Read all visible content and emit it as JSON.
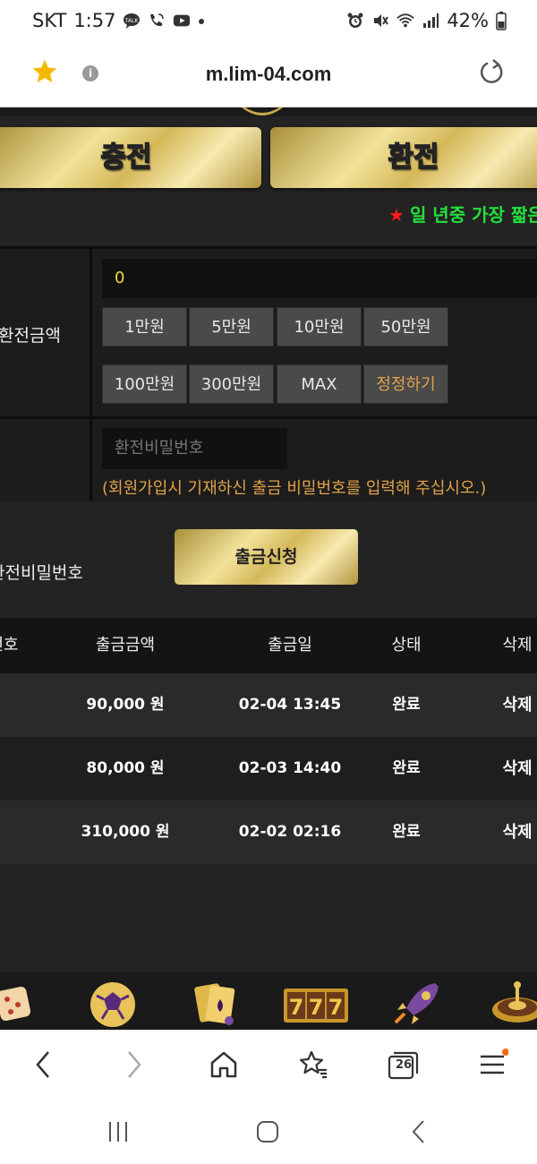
{
  "status_bar": {
    "carrier": "SKT",
    "time": "1:57",
    "battery": "42%",
    "left_icons": [
      "talk-icon",
      "wifi-call-icon",
      "youtube-icon",
      "dot-icon"
    ],
    "right_icons": [
      "alarm-icon",
      "mute-icon",
      "wifi-icon",
      "signal-icon",
      "battery-icon"
    ]
  },
  "browser": {
    "url": "m.lim-04.com",
    "tab_count": "26"
  },
  "tabs": {
    "deposit": "충전",
    "withdraw": "환전"
  },
  "marquee": {
    "text": "일 년중 가장 짧은"
  },
  "form": {
    "amount_label": "환전금액",
    "amount_value": "0",
    "amount_buttons": [
      "1만원",
      "5만원",
      "10만원",
      "50만원",
      "100만원",
      "300만원",
      "MAX",
      "정정하기"
    ],
    "password_label": "환전비밀번호",
    "password_placeholder": "환전비밀번호",
    "password_hint": "(회원가입시 기재하신 출금 비밀번호를 입력해 주십시오.)",
    "submit_label": "출금신청"
  },
  "table": {
    "headers": [
      "번호",
      "출금금액",
      "출금일",
      "상태",
      "삭제"
    ],
    "rows": [
      {
        "amount": "90,000 원",
        "date": "02-04 13:45",
        "status": "완료",
        "delete": "삭제"
      },
      {
        "amount": "80,000 원",
        "date": "02-03 14:40",
        "status": "완료",
        "delete": "삭제"
      },
      {
        "amount": "310,000 원",
        "date": "02-02 02:16",
        "status": "완료",
        "delete": "삭제"
      }
    ]
  },
  "games": [
    "dice-icon",
    "soccer-ball-icon",
    "cards-icon",
    "slot-777-icon",
    "rocket-icon",
    "roulette-icon"
  ],
  "colors": {
    "gold": "#d4b85a",
    "marquee_green": "#22e03a",
    "marquee_star": "#ff1b1b",
    "amount_value": "#f4d83a",
    "hint_orange": "#e0a24a",
    "dark_bg": "#232323"
  }
}
